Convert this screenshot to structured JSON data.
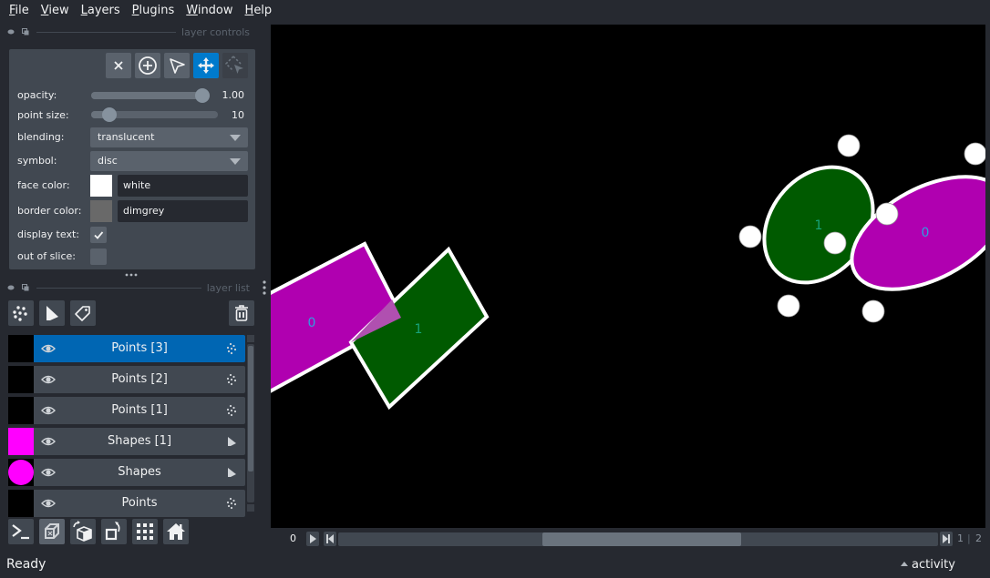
{
  "menu": {
    "items": [
      {
        "label": "File",
        "mnemonic": "F",
        "rest": "ile"
      },
      {
        "label": "View",
        "mnemonic": "V",
        "rest": "iew"
      },
      {
        "label": "Layers",
        "mnemonic": "L",
        "rest": "ayers"
      },
      {
        "label": "Plugins",
        "mnemonic": "P",
        "rest": "lugins"
      },
      {
        "label": "Window",
        "mnemonic": "W",
        "rest": "indow"
      },
      {
        "label": "Help",
        "mnemonic": "H",
        "rest": "elp"
      }
    ]
  },
  "layer_controls": {
    "title": "layer controls",
    "mode_buttons": [
      {
        "name": "delete-selected",
        "icon": "close-icon"
      },
      {
        "name": "add-points",
        "icon": "plus-circle-icon"
      },
      {
        "name": "select-points",
        "icon": "pointer-arrow-icon"
      },
      {
        "name": "pan-zoom",
        "icon": "move-arrows-icon",
        "active": true
      },
      {
        "name": "transform",
        "icon": "dashed-select-icon",
        "disabled": true
      }
    ],
    "opacity": {
      "label": "opacity:",
      "value": "1.00",
      "fraction": 1.0
    },
    "point_size": {
      "label": "point size:",
      "value": "10",
      "fraction": 0.09
    },
    "blending": {
      "label": "blending:",
      "value": "translucent"
    },
    "symbol": {
      "label": "symbol:",
      "value": "disc"
    },
    "face_color": {
      "label": "face color:",
      "value": "white",
      "swatch": "#ffffff"
    },
    "border_color": {
      "label": "border color:",
      "value": "dimgrey",
      "swatch": "#696969"
    },
    "display_text": {
      "label": "display text:",
      "checked": true
    },
    "out_of_slice": {
      "label": "out of slice:",
      "checked": false
    }
  },
  "layer_list": {
    "title": "layer list",
    "buttons": [
      {
        "name": "new-points-layer",
        "icon": "points-icon"
      },
      {
        "name": "new-shapes-layer",
        "icon": "polygon-icon"
      },
      {
        "name": "new-labels-layer",
        "icon": "tag-icon"
      },
      {
        "name": "delete-layer",
        "icon": "trash-icon"
      }
    ],
    "layers": [
      {
        "name": "Points [3]",
        "type": "points",
        "selected": true,
        "thumb": "#000000"
      },
      {
        "name": "Points [2]",
        "type": "points",
        "selected": false,
        "thumb": "#000000"
      },
      {
        "name": "Points [1]",
        "type": "points",
        "selected": false,
        "thumb": "#000000"
      },
      {
        "name": "Shapes [1]",
        "type": "shapes",
        "selected": false,
        "thumb": "#ff00ff"
      },
      {
        "name": "Shapes",
        "type": "shapes",
        "selected": false,
        "thumb": "#ff00ff",
        "thumb_shape": "circle"
      },
      {
        "name": "Points",
        "type": "points",
        "selected": false,
        "thumb": "#000000"
      }
    ]
  },
  "console_buttons": [
    {
      "name": "console",
      "icon": "terminal-icon"
    },
    {
      "name": "toggle-ndisplay",
      "icon": "cube-3d-icon",
      "active": true
    },
    {
      "name": "roll-dims",
      "icon": "rotate-cube-icon"
    },
    {
      "name": "transpose-dims",
      "icon": "transpose-icon"
    },
    {
      "name": "grid-view",
      "icon": "grid-icon"
    },
    {
      "name": "reset-view",
      "icon": "home-icon"
    }
  ],
  "canvas": {
    "shapes": [
      {
        "label": "0",
        "kind": "rectangle",
        "fill": "#b000b0",
        "label_color": "#2f9ee0"
      },
      {
        "label": "1",
        "kind": "rectangle",
        "fill": "#005a00",
        "label_color": "#17a37a"
      },
      {
        "label": "1",
        "kind": "ellipse",
        "fill": "#005a00",
        "label_color": "#17a37a"
      },
      {
        "label": "0",
        "kind": "ellipse",
        "fill": "#b000b0",
        "label_color": "#2f9ee0"
      }
    ],
    "points_face": "#ffffff"
  },
  "dims": {
    "current": "0",
    "current_step": "1",
    "total": "2",
    "position_fraction": 0.34
  },
  "status": {
    "message": "Ready",
    "activity_label": "activity"
  }
}
